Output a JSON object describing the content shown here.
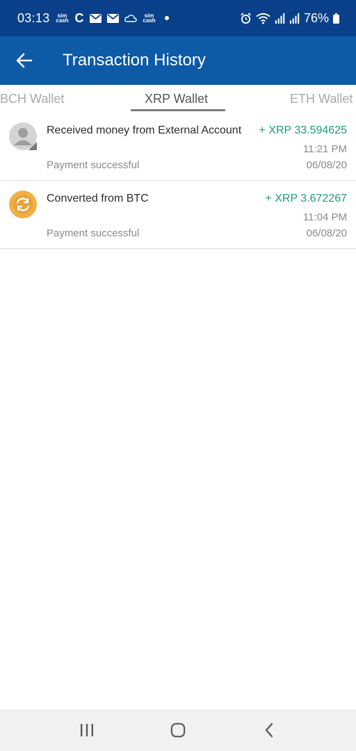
{
  "status_bar": {
    "time": "03:13",
    "sim_label": "sim\ncash",
    "c_glyph": "C",
    "battery": "76%",
    "icons": [
      "sim-cash-icon",
      "c-icon",
      "mail-icon",
      "mail-icon",
      "cloud-icon",
      "sim-cash-icon",
      "dot-icon",
      "alarm-icon",
      "wifi-icon",
      "signal-icon",
      "signal-icon",
      "battery-icon"
    ]
  },
  "app_bar": {
    "back_icon": "arrow-left-icon",
    "title": "Transaction History"
  },
  "tabs": [
    {
      "label": "BCH Wallet",
      "selected": false
    },
    {
      "label": "XRP Wallet",
      "selected": true
    },
    {
      "label": "ETH Wallet",
      "selected": false
    }
  ],
  "transactions": [
    {
      "icon": "user-avatar-icon",
      "title": "Received money from External Account",
      "amount": "+ XRP 33.594625",
      "time": "11:21 PM",
      "status": "Payment successful",
      "date": "06/08/20"
    },
    {
      "icon": "convert-icon",
      "title": "Converted from BTC",
      "amount": "+ XRP 3.672267",
      "time": "11:04 PM",
      "status": "Payment successful",
      "date": "06/08/20"
    }
  ],
  "nav_bar": {
    "icons": [
      "recent-apps-icon",
      "home-icon",
      "back-icon"
    ]
  },
  "colors": {
    "status_bar": "#0a3f8a",
    "app_bar": "#0d5aa7",
    "amount": "#1f9a7e",
    "convert_icon": "#f0b044"
  }
}
